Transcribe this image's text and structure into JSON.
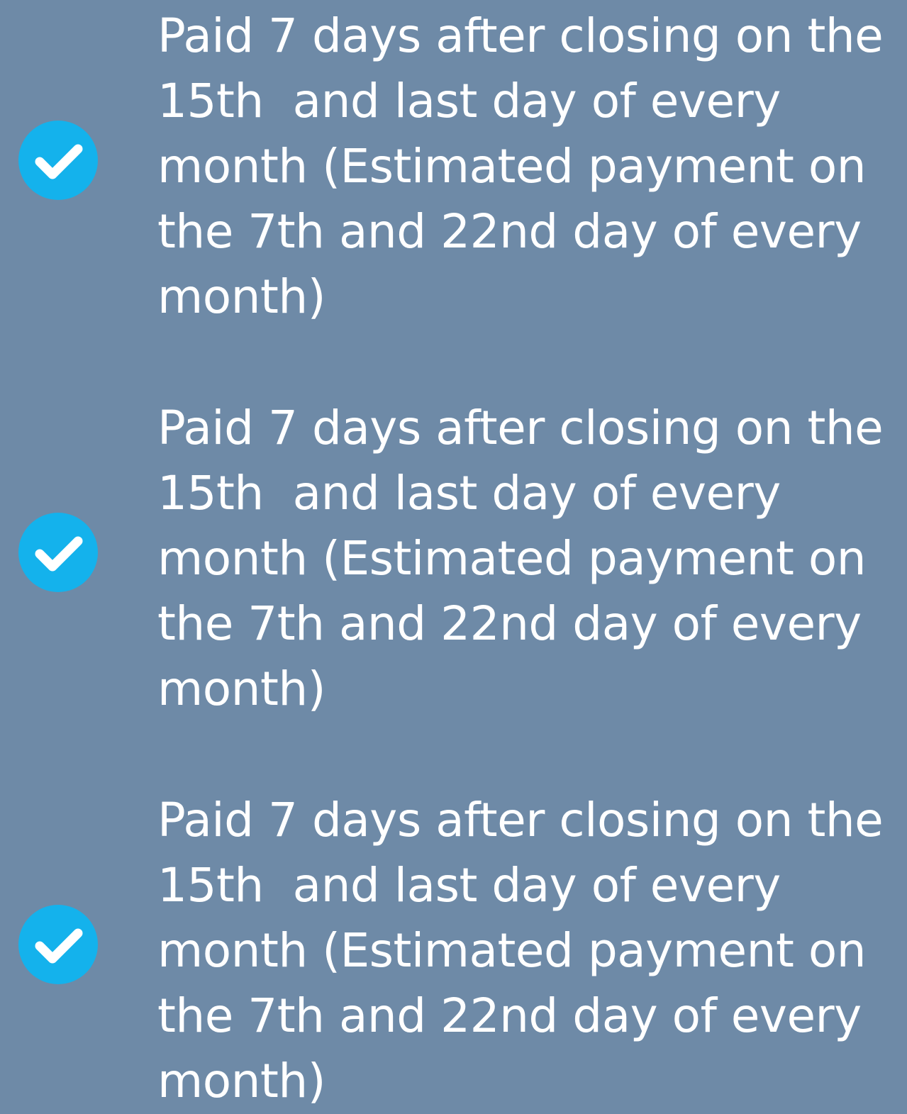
{
  "items": [
    {
      "check_icon": "check-circle-icon",
      "lines": [
        "Paid 7 days after closing on the",
        "15th  and last day of every",
        "month (Estimated payment on",
        "the 7th and 22nd day of every",
        "month)"
      ]
    },
    {
      "check_icon": "check-circle-icon",
      "lines": [
        "Paid 7 days after closing on the",
        "15th  and last day of every",
        "month (Estimated payment on",
        "the 7th and 22nd day of every",
        "month)"
      ]
    },
    {
      "check_icon": "check-circle-icon",
      "lines": [
        "Paid 7 days after closing on the",
        "15th  and last day of every",
        "month (Estimated payment on",
        "the 7th and 22nd day of every",
        "month)"
      ]
    }
  ],
  "colors": {
    "background": "#6e8aa7",
    "check_badge": "#14b2ec",
    "text": "#ffffff"
  }
}
